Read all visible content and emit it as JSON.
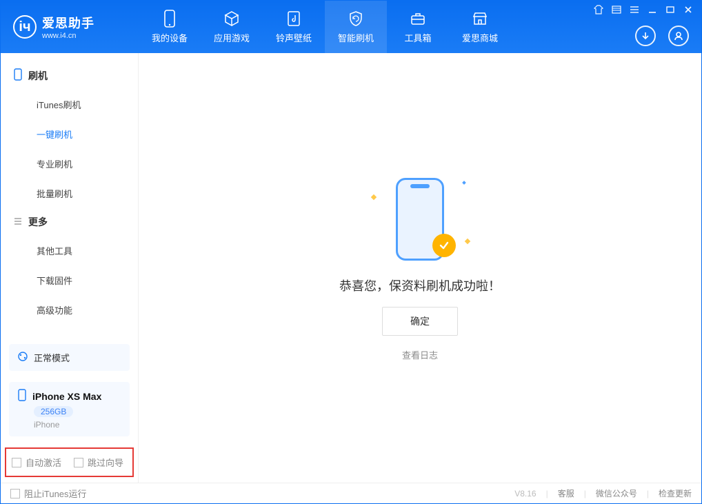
{
  "header": {
    "logo_title": "爱思助手",
    "logo_subtitle": "www.i4.cn",
    "tabs": [
      {
        "label": "我的设备",
        "icon": "phone-icon"
      },
      {
        "label": "应用游戏",
        "icon": "cube-icon"
      },
      {
        "label": "铃声壁纸",
        "icon": "music-icon"
      },
      {
        "label": "智能刷机",
        "icon": "shield-refresh-icon",
        "active": true
      },
      {
        "label": "工具箱",
        "icon": "toolbox-icon"
      },
      {
        "label": "爱思商城",
        "icon": "store-icon"
      }
    ]
  },
  "sidebar": {
    "group1_title": "刷机",
    "group1_items": [
      "iTunes刷机",
      "一键刷机",
      "专业刷机",
      "批量刷机"
    ],
    "group1_active_index": 1,
    "group2_title": "更多",
    "group2_items": [
      "其他工具",
      "下载固件",
      "高级功能"
    ],
    "mode_label": "正常模式",
    "device_name": "iPhone XS Max",
    "device_capacity": "256GB",
    "device_type": "iPhone",
    "chk_auto_activate": "自动激活",
    "chk_skip_guide": "跳过向导"
  },
  "main": {
    "success_message": "恭喜您，保资料刷机成功啦！",
    "ok_button": "确定",
    "view_log": "查看日志"
  },
  "footer": {
    "block_itunes": "阻止iTunes运行",
    "version": "V8.16",
    "links": [
      "客服",
      "微信公众号",
      "检查更新"
    ]
  },
  "colors": {
    "primary": "#1a7cf6",
    "accent": "#ffb400",
    "danger_border": "#e53935"
  }
}
